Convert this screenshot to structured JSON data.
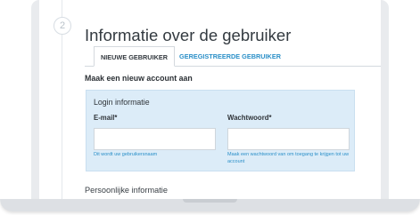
{
  "step": {
    "number": "2"
  },
  "page": {
    "title": "Informatie over de gebruiker"
  },
  "tabs": [
    {
      "label": "NIEUWE GEBRUIKER",
      "active": true
    },
    {
      "label": "GEREGISTREERDE GEBRUIKER",
      "active": false
    }
  ],
  "form": {
    "heading": "Maak een nieuw account aan",
    "login": {
      "title": "Login informatie",
      "email": {
        "label": "E-mail*",
        "value": "",
        "help": "Dit wordt uw gebruikersnaam"
      },
      "password": {
        "label": "Wachtwoord*",
        "value": "",
        "help": "Maak een wachtwoord van om toegang te krijgen tot uw account"
      }
    },
    "personal": {
      "title": "Persoonlijke informatie"
    }
  },
  "colors": {
    "accent": "#2a8fc8",
    "panel_bg": "#dcecf8",
    "frame": "#e9ebee"
  }
}
